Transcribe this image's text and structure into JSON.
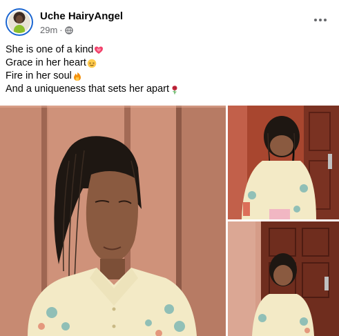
{
  "post": {
    "author": "Uche HairyAngel",
    "time": "29m",
    "separator": "·",
    "privacy_icon": "globe-icon",
    "caption_lines": [
      {
        "text": "She is one of a kind",
        "emoji": "sparkling-heart"
      },
      {
        "text": "Grace in her heart",
        "emoji": "relieved-face"
      },
      {
        "text": "Fire in her soul",
        "emoji": "fire"
      },
      {
        "text": "And a uniqueness that sets her apart",
        "emoji": "rose"
      }
    ],
    "photos": [
      "main-photo",
      "top-right-photo",
      "bottom-right-photo"
    ]
  },
  "colors": {
    "text": "#050505",
    "meta": "#65676b",
    "avatar_ring": "#1b66d1"
  }
}
